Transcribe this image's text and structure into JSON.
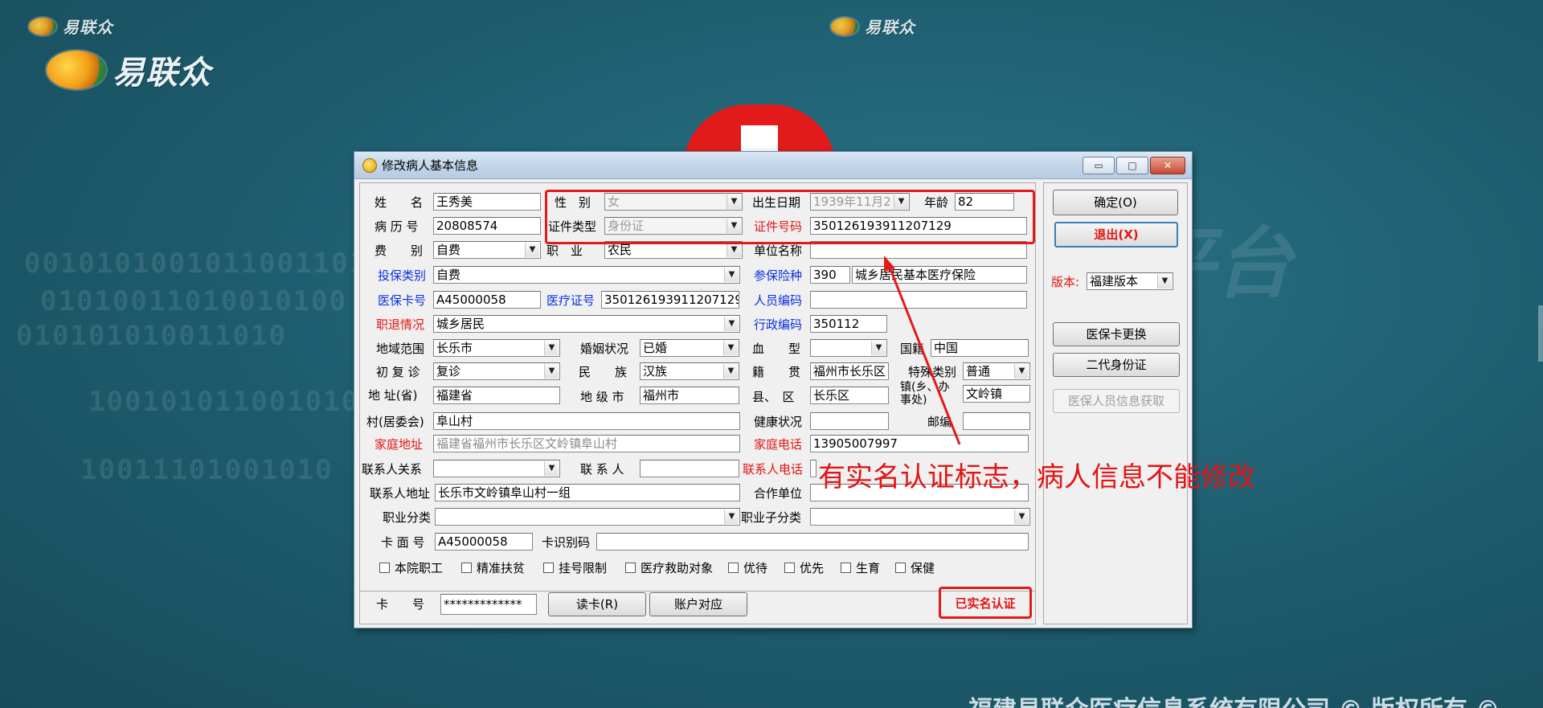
{
  "background": {
    "logo_text": "易联众",
    "watermark_text": "息平台",
    "binary_lines": [
      "0010101001011001101",
      "01010011010010100",
      "010101010011010",
      "1001010110010101",
      "10011101001010"
    ],
    "footer": "福建易联众医疗信息系统有限公司 © 版权所有 ©"
  },
  "dialog": {
    "title": "修改病人基本信息",
    "window_controls": {
      "minimize": "▭",
      "maximize": "□",
      "close": "✕"
    },
    "form": {
      "name": {
        "label": "姓　　名",
        "value": "王秀美"
      },
      "gender": {
        "label": "性　别",
        "value": "女"
      },
      "birth_date": {
        "label": "出生日期",
        "value": "1939年11月2"
      },
      "age": {
        "label": "年龄",
        "value": "82"
      },
      "record_no": {
        "label": "病 历 号",
        "value": "20808574"
      },
      "id_type": {
        "label": "证件类型",
        "value": "身份证"
      },
      "id_no": {
        "label": "证件号码",
        "value": "350126193911207129"
      },
      "fee_type": {
        "label": "费　　别",
        "value": "自费"
      },
      "occupation": {
        "label": "职　业",
        "value": "农民"
      },
      "employer": {
        "label": "单位名称",
        "value": ""
      },
      "insured_category": {
        "label": "投保类别",
        "value": "自费"
      },
      "insurance_type": {
        "label": "参保险种",
        "code": "390",
        "value": "城乡居民基本医疗保险"
      },
      "insurance_card_no": {
        "label": "医保卡号",
        "value": "A45000058"
      },
      "medical_cert_no": {
        "label": "医疗证号",
        "value": "350126193911207129"
      },
      "person_code": {
        "label": "人员编码",
        "value": ""
      },
      "retire_status": {
        "label": "职退情况",
        "value": "城乡居民"
      },
      "admin_code": {
        "label": "行政编码",
        "value": "350112"
      },
      "region": {
        "label": "地域范围",
        "value": "长乐市"
      },
      "marital": {
        "label": "婚姻状况",
        "value": "已婚"
      },
      "blood_type": {
        "label": "血　　型",
        "value": ""
      },
      "nationality": {
        "label": "国籍",
        "value": "中国"
      },
      "visit_type": {
        "label": "初 复 诊",
        "value": "复诊"
      },
      "ethnicity": {
        "label": "民　　族",
        "value": "汉族"
      },
      "native_place": {
        "label": "籍　　贯",
        "value": "福州市长乐区"
      },
      "special_category": {
        "label": "特殊类别",
        "value": "普通"
      },
      "province": {
        "label": "地 址(省)",
        "value": "福建省"
      },
      "city": {
        "label": "地 级 市",
        "value": "福州市"
      },
      "county": {
        "label": "县、　区",
        "value": "长乐区"
      },
      "town": {
        "label": "镇(乡、办事处)",
        "value": "文岭镇"
      },
      "village": {
        "label": "村(居委会)",
        "value": "阜山村"
      },
      "health": {
        "label": "健康状况",
        "value": ""
      },
      "postcode": {
        "label": "邮编",
        "value": ""
      },
      "home_address": {
        "label": "家庭地址",
        "value": "福建省福州市长乐区文岭镇阜山村"
      },
      "home_phone": {
        "label": "家庭电话",
        "value": "13905007997"
      },
      "contact_relation": {
        "label": "联系人关系",
        "value": ""
      },
      "contact_person": {
        "label": "联 系 人",
        "value": ""
      },
      "contact_phone": {
        "label": "联系人电话",
        "value": ""
      },
      "contact_address": {
        "label": "联系人地址",
        "value": "长乐市文岭镇阜山村一组"
      },
      "coop_unit": {
        "label": "合作单位",
        "value": ""
      },
      "occupation_class": {
        "label": "职业分类",
        "value": ""
      },
      "occupation_subclass": {
        "label": "职业子分类",
        "value": ""
      },
      "card_face_no": {
        "label": "卡 面 号",
        "value": "A45000058"
      },
      "card_id_code": {
        "label": "卡识别码",
        "value": ""
      },
      "checkboxes": [
        "本院职工",
        "精准扶贫",
        "挂号限制",
        "医疗救助对象",
        "优待",
        "优先",
        "生育",
        "保健"
      ]
    },
    "bottom": {
      "card_label": "卡　　号",
      "card_value": "*************",
      "read_card": "读卡(R)",
      "account_match": "账户对应",
      "realname_badge": "已实名认证"
    },
    "side": {
      "ok": "确定(O)",
      "exit": "退出(X)",
      "version_label": "版本:",
      "version_value": "福建版本",
      "replace_card": "医保卡更换",
      "second_id": "二代身份证",
      "fetch_info": "医保人员信息获取"
    }
  },
  "annotation": {
    "text": "有实名认证标志，病人信息不能修改",
    "color": "#e31414"
  }
}
